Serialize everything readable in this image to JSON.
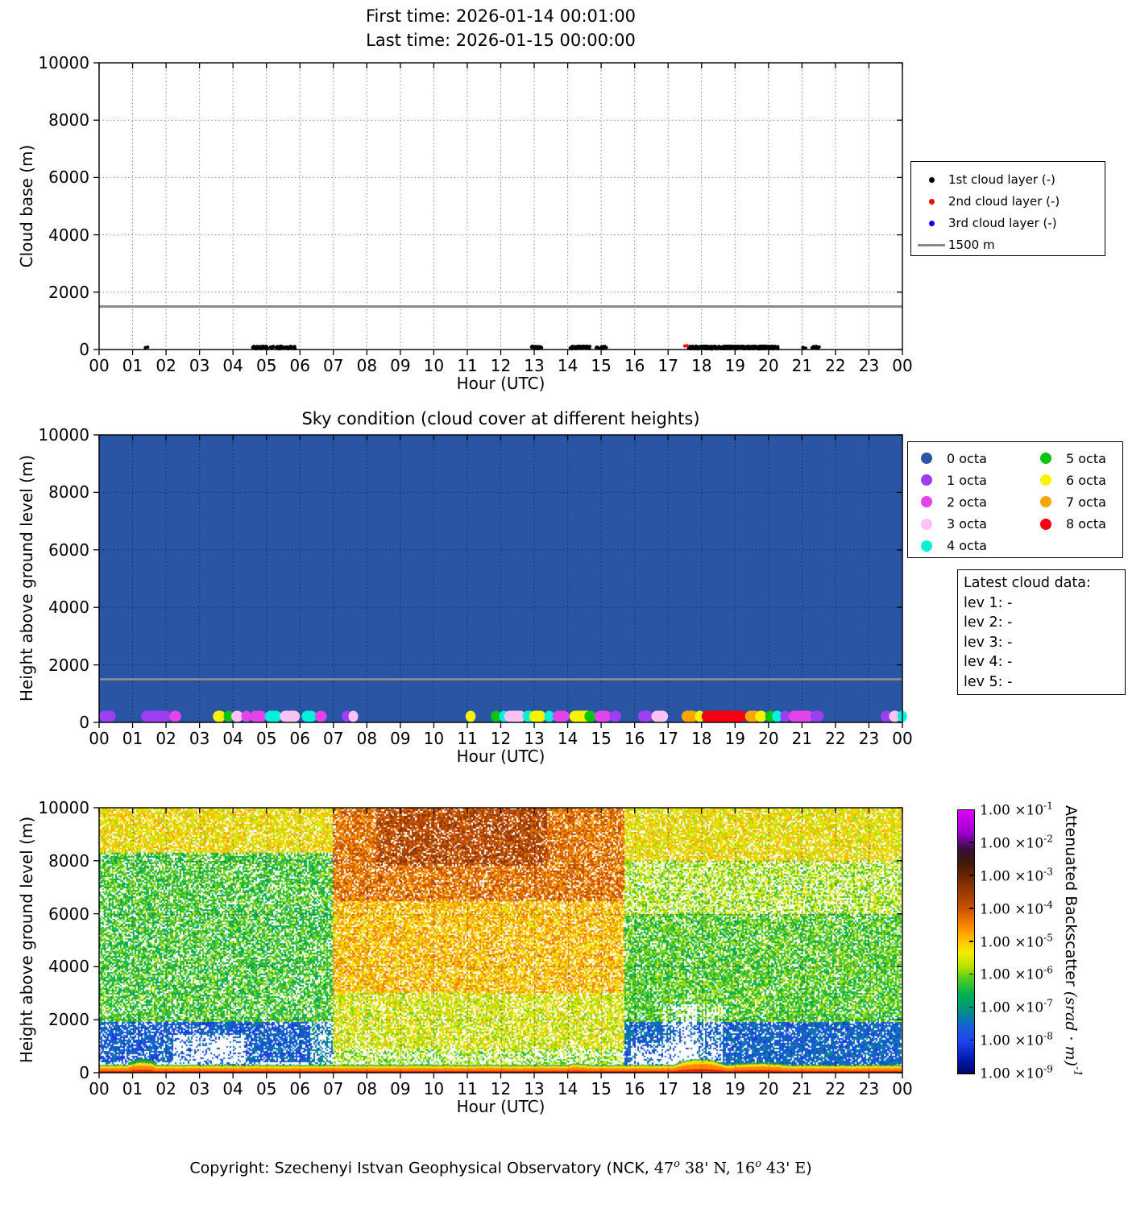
{
  "axes": {
    "hour_labels": [
      "00",
      "01",
      "02",
      "03",
      "04",
      "05",
      "06",
      "07",
      "08",
      "09",
      "10",
      "11",
      "12",
      "13",
      "14",
      "15",
      "16",
      "17",
      "18",
      "19",
      "20",
      "21",
      "22",
      "23",
      "00"
    ],
    "height_labels": [
      "0",
      "2000",
      "4000",
      "6000",
      "8000",
      "10000"
    ]
  },
  "chart_data": [
    {
      "type": "scatter",
      "title_lines": [
        "First time: 2026-01-14 00:01:00",
        "Last time: 2026-01-15 00:00:00"
      ],
      "xlabel": "Hour (UTC)",
      "ylabel": "Cloud base (m)",
      "xlim": [
        0,
        24
      ],
      "ylim": [
        0,
        10000
      ],
      "yticks": [
        0,
        2000,
        4000,
        6000,
        8000,
        10000
      ],
      "grid": true,
      "refline": {
        "value": 1500,
        "color": "#888888"
      },
      "legend_position": "right-outside",
      "legend": [
        {
          "label": "1st cloud layer (-)",
          "color": "#000000",
          "marker": "dot"
        },
        {
          "label": "2nd cloud layer (-)",
          "color": "#ff0000",
          "marker": "dot"
        },
        {
          "label": "3rd cloud layer (-)",
          "color": "#0000ff",
          "marker": "dot"
        },
        {
          "label": "1500 m",
          "color": "#888888",
          "marker": "line"
        }
      ],
      "series": [
        {
          "name": "1st cloud layer",
          "color": "#000000",
          "base_height_m": 70,
          "clusters": [
            [
              1.38,
              1.44,
              2
            ],
            [
              4.6,
              5.02,
              50
            ],
            [
              5.12,
              5.22,
              6
            ],
            [
              5.3,
              5.52,
              18
            ],
            [
              5.56,
              5.86,
              22
            ],
            [
              12.92,
              13.22,
              22
            ],
            [
              14.08,
              14.66,
              50
            ],
            [
              14.85,
              14.92,
              4
            ],
            [
              15.0,
              15.16,
              10
            ],
            [
              17.62,
              20.28,
              420
            ],
            [
              21.02,
              21.1,
              4
            ],
            [
              21.3,
              21.5,
              10
            ]
          ]
        },
        {
          "name": "2nd cloud layer",
          "color": "#ff0000",
          "base_height_m": 120,
          "clusters": [
            [
              17.5,
              17.58,
              2
            ]
          ]
        },
        {
          "name": "3rd cloud layer",
          "color": "#0000ff",
          "base_height_m": 0,
          "clusters": []
        }
      ]
    },
    {
      "type": "timeline-octa",
      "title": "Sky condition (cloud cover at different heights)",
      "xlabel": "Hour (UTC)",
      "ylabel": "Height above ground level (m)",
      "xlim": [
        0,
        24
      ],
      "ylim": [
        0,
        10000
      ],
      "background_octa": 0,
      "refline": {
        "value": 1500,
        "color": "#909090"
      },
      "octa_colors": {
        "0": "#2955a4",
        "1": "#9c3ff2",
        "2": "#e243ea",
        "3": "#fbc3f3",
        "4": "#00f0d8",
        "5": "#0cc410",
        "6": "#f8f400",
        "7": "#f9a602",
        "8": "#f60012"
      },
      "legend": [
        {
          "label": "0 octa",
          "octa": 0
        },
        {
          "label": "1 octa",
          "octa": 1
        },
        {
          "label": "2 octa",
          "octa": 2
        },
        {
          "label": "3 octa",
          "octa": 3
        },
        {
          "label": "4 octa",
          "octa": 4
        },
        {
          "label": "5 octa",
          "octa": 5
        },
        {
          "label": "6 octa",
          "octa": 6
        },
        {
          "label": "7 octa",
          "octa": 7
        },
        {
          "label": "8 octa",
          "octa": 8
        }
      ],
      "info_box": {
        "title": "Latest cloud data:",
        "lines": [
          "lev 1: -",
          "lev 2: -",
          "lev 3: -",
          "lev 4: -",
          "lev 5: -"
        ]
      },
      "segments": [
        [
          0.0,
          0.5,
          1
        ],
        [
          1.25,
          2.15,
          1
        ],
        [
          2.1,
          2.45,
          2
        ],
        [
          3.4,
          3.78,
          6
        ],
        [
          3.72,
          4.02,
          5
        ],
        [
          3.95,
          4.3,
          3
        ],
        [
          4.25,
          4.55,
          2
        ],
        [
          4.5,
          5.0,
          2
        ],
        [
          4.95,
          5.45,
          4
        ],
        [
          5.4,
          6.0,
          3
        ],
        [
          6.05,
          6.5,
          4
        ],
        [
          6.45,
          6.8,
          2
        ],
        [
          7.25,
          7.52,
          1
        ],
        [
          7.45,
          7.7,
          3
        ],
        [
          10.95,
          11.25,
          6
        ],
        [
          11.7,
          12.02,
          5
        ],
        [
          11.95,
          12.2,
          4
        ],
        [
          12.1,
          12.75,
          3
        ],
        [
          12.65,
          13.02,
          4
        ],
        [
          12.85,
          13.35,
          6
        ],
        [
          13.3,
          13.6,
          4
        ],
        [
          13.55,
          14.05,
          2
        ],
        [
          14.05,
          14.75,
          6
        ],
        [
          14.5,
          14.85,
          5
        ],
        [
          14.8,
          15.3,
          2
        ],
        [
          15.25,
          15.6,
          1
        ],
        [
          16.1,
          16.55,
          1
        ],
        [
          16.5,
          17.0,
          3
        ],
        [
          17.4,
          17.9,
          7
        ],
        [
          17.8,
          18.05,
          6
        ],
        [
          18.0,
          19.35,
          8
        ],
        [
          19.3,
          19.75,
          7
        ],
        [
          19.6,
          19.95,
          6
        ],
        [
          19.9,
          20.2,
          5
        ],
        [
          20.1,
          20.42,
          4
        ],
        [
          20.35,
          20.65,
          1
        ],
        [
          20.6,
          21.35,
          2
        ],
        [
          21.25,
          21.65,
          1
        ],
        [
          23.35,
          23.7,
          1
        ],
        [
          23.6,
          23.95,
          3
        ],
        [
          23.85,
          24.0,
          4
        ]
      ]
    },
    {
      "type": "heatmap",
      "xlabel": "Hour (UTC)",
      "ylabel": "Height above ground level (m)",
      "xlim": [
        0,
        24
      ],
      "ylim": [
        0,
        10000
      ],
      "colorbar": {
        "mantissa": "1.00 ×10",
        "exponents": [
          "-1",
          "-2",
          "-3",
          "-4",
          "-5",
          "-6",
          "-7",
          "-8",
          "-9"
        ],
        "title": "Attenuated Backscatter ",
        "units": "(srad · m)",
        "units_exp": "-1",
        "scale": "log10"
      },
      "cmap_stops": [
        [
          -1,
          "#e000ff"
        ],
        [
          -1.7,
          "#9900cc"
        ],
        [
          -2.2,
          "#3a0d3a"
        ],
        [
          -2.6,
          "#3f1a08"
        ],
        [
          -3,
          "#6b2600"
        ],
        [
          -4,
          "#cc5200"
        ],
        [
          -4.6,
          "#ff9100"
        ],
        [
          -5,
          "#ffc800"
        ],
        [
          -5.35,
          "#f0ee00"
        ],
        [
          -5.8,
          "#b0e000"
        ],
        [
          -6.1,
          "#55cc22"
        ],
        [
          -6.6,
          "#00b050"
        ],
        [
          -7,
          "#009977"
        ],
        [
          -7.5,
          "#1166cc"
        ],
        [
          -8,
          "#2244ee"
        ],
        [
          -8.6,
          "#0018aa"
        ],
        [
          -9,
          "#000566"
        ]
      ],
      "regions": [
        {
          "h": [
            0,
            7.0
          ],
          "z": [
            8300,
            10000
          ],
          "v": -5.25,
          "d": 0.8
        },
        {
          "h": [
            0,
            7.0
          ],
          "z": [
            1800,
            8300
          ],
          "v": -6.3,
          "d": 0.72
        },
        {
          "h": [
            0,
            7.0
          ],
          "z": [
            380,
            1900
          ],
          "v": -7.7,
          "d": 0.8
        },
        {
          "h": [
            0,
            7.0
          ],
          "z": [
            150,
            380
          ],
          "v": -7.5,
          "d": 0.2
        },
        {
          "h": [
            2.2,
            4.4
          ],
          "z": [
            260,
            1450
          ],
          "v": -7.7,
          "d": 0.22
        },
        {
          "h": [
            6.3,
            7.3
          ],
          "z": [
            150,
            1900
          ],
          "v": -7.3,
          "d": 0.45
        },
        {
          "h": [
            7.0,
            15.7
          ],
          "z": [
            6500,
            10000
          ],
          "v": -4.3,
          "d": 0.82
        },
        {
          "h": [
            8.3,
            13.4
          ],
          "z": [
            7800,
            10000
          ],
          "v": -3.8,
          "d": 0.85
        },
        {
          "h": [
            7.0,
            15.7
          ],
          "z": [
            3000,
            6500
          ],
          "v": -4.9,
          "d": 0.8
        },
        {
          "h": [
            7.0,
            15.7
          ],
          "z": [
            900,
            3000
          ],
          "v": -5.5,
          "d": 0.72
        },
        {
          "h": [
            7.0,
            15.7
          ],
          "z": [
            150,
            900
          ],
          "v": -5.9,
          "d": 0.5
        },
        {
          "h": [
            15.7,
            24
          ],
          "z": [
            8000,
            10000
          ],
          "v": -5.3,
          "d": 0.82
        },
        {
          "h": [
            15.7,
            24
          ],
          "z": [
            6000,
            8000
          ],
          "v": -5.8,
          "d": 0.6
        },
        {
          "h": [
            15.7,
            24
          ],
          "z": [
            1900,
            6000
          ],
          "v": -6.2,
          "d": 0.78
        },
        {
          "h": [
            15.7,
            24
          ],
          "z": [
            300,
            1900
          ],
          "v": -7.6,
          "d": 0.85
        },
        {
          "h": [
            15.9,
            17.9
          ],
          "z": [
            260,
            1100
          ],
          "v": -7.6,
          "d": 0.3
        }
      ],
      "ground_band": {
        "base_top_m": 250,
        "bumps": [
          {
            "h": [
              0.85,
              1.7
            ],
            "top": 380,
            "green": true
          },
          {
            "h": [
              14.0,
              14.6
            ],
            "top": 300
          },
          {
            "h": [
              17.15,
              18.75
            ],
            "top": 470
          },
          {
            "h": [
              18.75,
              20.6
            ],
            "top": 330
          }
        ]
      }
    }
  ],
  "copyright": {
    "segments": [
      {
        "text": "Copyright: Szechenyi Istvan Geophysical Observatory (NCK, ",
        "style": "sans"
      },
      {
        "text": "47",
        "style": "math"
      },
      {
        "text": "o",
        "style": "sup"
      },
      {
        "text": " 38' N, ",
        "style": "math"
      },
      {
        "text": "16",
        "style": "math"
      },
      {
        "text": "o",
        "style": "sup"
      },
      {
        "text": " 43' E",
        "style": "math"
      },
      {
        "text": ")",
        "style": "sans"
      }
    ]
  }
}
